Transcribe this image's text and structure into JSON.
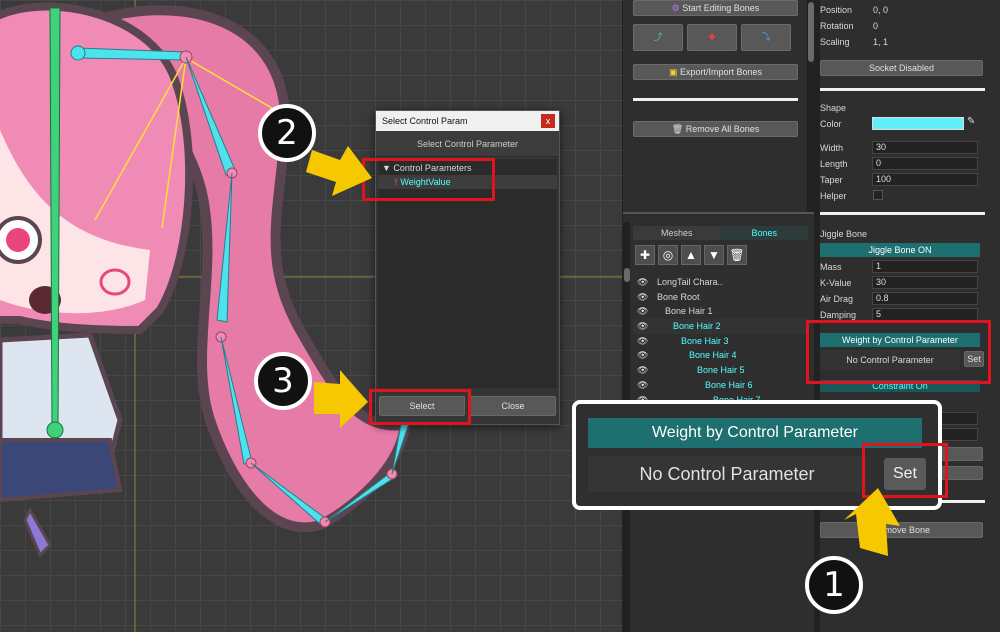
{
  "dialog": {
    "title": "Select Control Param",
    "close_glyph": "x",
    "header": "Select Control Parameter",
    "tree": [
      {
        "label": "Control Parameters",
        "expanded": true
      },
      {
        "label": "WeightValue",
        "selected": true
      }
    ],
    "select_label": "Select",
    "close_label": "Close"
  },
  "toolbar": {
    "start_editing": "Start Editing Bones",
    "export_import": "Export/Import Bones",
    "remove_all": "Remove All Bones"
  },
  "tabs": {
    "meshes": "Meshes",
    "bones": "Bones"
  },
  "bone_tree": [
    {
      "label": "LongTail Chara.."
    },
    {
      "label": "Bone Root"
    },
    {
      "label": "Bone Hair 1"
    },
    {
      "label": "Bone Hair 2"
    },
    {
      "label": "Bone Hair 3"
    },
    {
      "label": "Bone Hair 4"
    },
    {
      "label": "Bone Hair 5"
    },
    {
      "label": "Bone Hair 6"
    },
    {
      "label": "Bone Hair 7"
    }
  ],
  "transform": {
    "position_label": "Position",
    "position_value": "0, 0",
    "rotation_label": "Rotation",
    "rotation_value": "0",
    "scaling_label": "Scaling",
    "scaling_value": "1, 1",
    "socket": "Socket Disabled"
  },
  "shape": {
    "title": "Shape",
    "color_label": "Color",
    "color_value": "#5ff0f8",
    "width_label": "Width",
    "width_value": "30",
    "length_label": "Length",
    "length_value": "0",
    "taper_label": "Taper",
    "taper_value": "100",
    "helper_label": "Helper"
  },
  "jiggle": {
    "title": "Jiggle Bone",
    "toggle": "Jiggle Bone ON",
    "mass_label": "Mass",
    "mass_value": "1",
    "k_label": "K-Value",
    "k_value": "30",
    "drag_label": "Air Drag",
    "drag_value": "0.8",
    "damping_label": "Damping",
    "damping_value": "5",
    "weight_header": "Weight by Control Parameter",
    "no_param": "No Control Parameter",
    "set_label": "Set",
    "constraint": "Constraint On",
    "remove_bone": "Remove Bone"
  },
  "callout": {
    "header": "Weight by Control Parameter",
    "no_param": "No Control Parameter",
    "set_label": "Set"
  },
  "steps": {
    "one": "1",
    "two": "2",
    "three": "3"
  }
}
